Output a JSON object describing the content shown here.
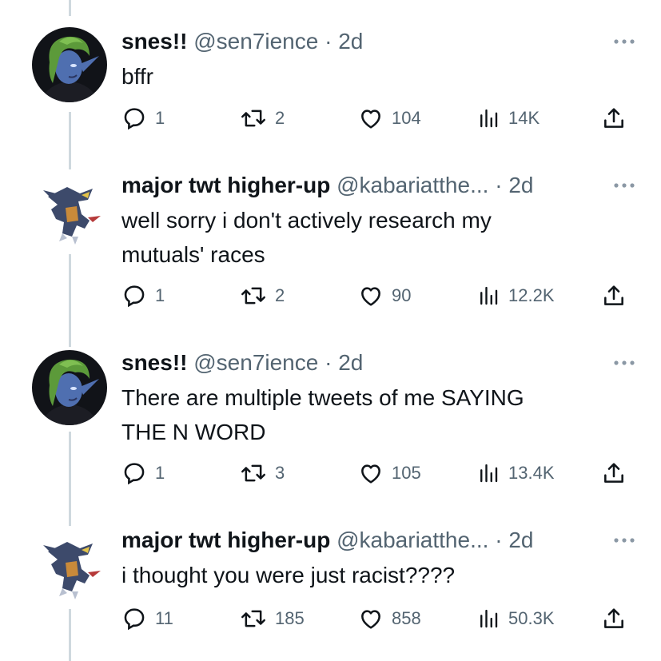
{
  "tweets": [
    {
      "name": "snes!!",
      "handle": "@sen7ience",
      "time": "2d",
      "avatar": "green-hair-elf-avatar",
      "lines": [
        "bffr"
      ],
      "replies": "1",
      "retweets": "2",
      "likes": "104",
      "views": "14K"
    },
    {
      "name": "major twt higher-up",
      "handle": "@kabariatthe...",
      "time": "2d",
      "avatar": "garchomp-avatar",
      "lines": [
        "well sorry i don't actively research my",
        "mutuals' races"
      ],
      "replies": "1",
      "retweets": "2",
      "likes": "90",
      "views": "12.2K"
    },
    {
      "name": "snes!!",
      "handle": "@sen7ience",
      "time": "2d",
      "avatar": "green-hair-elf-avatar",
      "lines": [
        "There are multiple tweets of me SAYING",
        "THE N WORD"
      ],
      "replies": "1",
      "retweets": "3",
      "likes": "105",
      "views": "13.4K"
    },
    {
      "name": "major twt higher-up",
      "handle": "@kabariatthe...",
      "time": "2d",
      "avatar": "garchomp-avatar",
      "lines": [
        "i thought you were just racist????"
      ],
      "replies": "11",
      "retweets": "185",
      "likes": "858",
      "views": "50.3K"
    }
  ],
  "separator": "·",
  "colors": {
    "text": "#0f1419",
    "secondary": "#536471",
    "thread_line": "#cfd9de"
  }
}
